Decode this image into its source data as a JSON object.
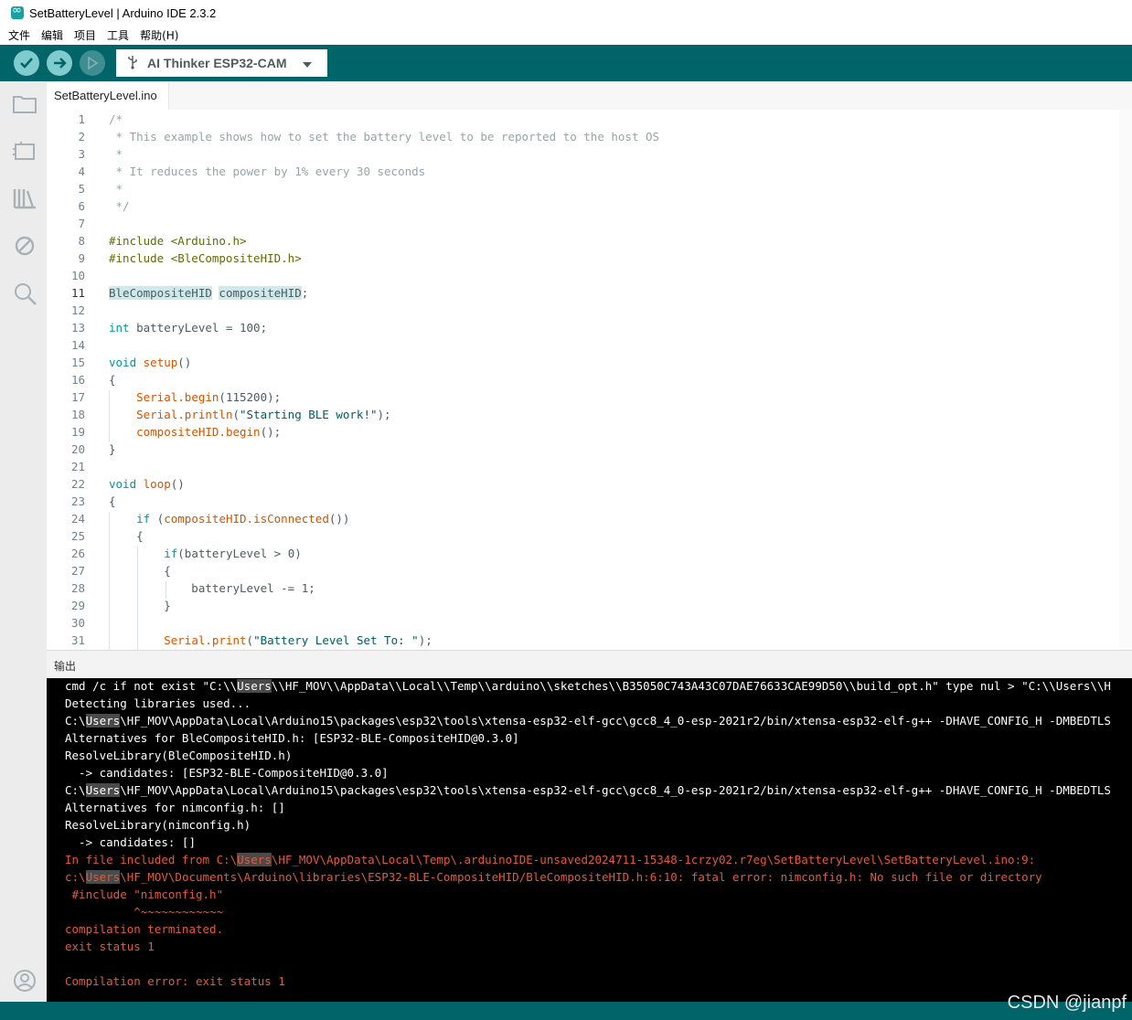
{
  "window": {
    "title": "SetBatteryLevel | Arduino IDE 2.3.2"
  },
  "menu": [
    "文件",
    "编辑",
    "项目",
    "工具",
    "帮助(H)"
  ],
  "toolbar": {
    "board": "AI Thinker ESP32-CAM"
  },
  "tab": {
    "label": "SetBatteryLevel.ino"
  },
  "editor": {
    "active_line": 11,
    "lines": [
      "/*",
      " * This example shows how to set the battery level to be reported to the host OS",
      " *",
      " * It reduces the power by 1% every 30 seconds",
      " *",
      " */",
      "",
      "#include <Arduino.h>",
      "#include <BleCompositeHID.h>",
      "",
      "BleCompositeHID compositeHID;",
      "",
      "int batteryLevel = 100;",
      "",
      "void setup()",
      "{",
      "    Serial.begin(115200);",
      "    Serial.println(\"Starting BLE work!\");",
      "    compositeHID.begin();",
      "}",
      "",
      "void loop()",
      "{",
      "    if (compositeHID.isConnected())",
      "    {",
      "        if(batteryLevel > 0)",
      "        {",
      "            batteryLevel -= 1;",
      "        }",
      "",
      "        Serial.print(\"Battery Level Set To: \");"
    ]
  },
  "output": {
    "label": "输出",
    "lines": [
      {
        "text": "cmd /c if not exist \"C:\\\\Users\\\\HF_MOV\\\\AppData\\\\Local\\\\Temp\\\\arduino\\\\sketches\\\\B35050C743A43C07DAE76633CAE99D50\\\\build_opt.h\" type nul > \"C:\\\\Users\\\\H",
        "err": false
      },
      {
        "text": "Detecting libraries used...",
        "err": false
      },
      {
        "text": "C:\\Users\\HF_MOV\\AppData\\Local\\Arduino15\\packages\\esp32\\tools\\xtensa-esp32-elf-gcc\\gcc8_4_0-esp-2021r2/bin/xtensa-esp32-elf-g++ -DHAVE_CONFIG_H -DMBEDTLS",
        "err": false
      },
      {
        "text": "Alternatives for BleCompositeHID.h: [ESP32-BLE-CompositeHID@0.3.0]",
        "err": false
      },
      {
        "text": "ResolveLibrary(BleCompositeHID.h)",
        "err": false
      },
      {
        "text": "  -> candidates: [ESP32-BLE-CompositeHID@0.3.0]",
        "err": false
      },
      {
        "text": "C:\\Users\\HF_MOV\\AppData\\Local\\Arduino15\\packages\\esp32\\tools\\xtensa-esp32-elf-gcc\\gcc8_4_0-esp-2021r2/bin/xtensa-esp32-elf-g++ -DHAVE_CONFIG_H -DMBEDTLS",
        "err": false
      },
      {
        "text": "Alternatives for nimconfig.h: []",
        "err": false
      },
      {
        "text": "ResolveLibrary(nimconfig.h)",
        "err": false
      },
      {
        "text": "  -> candidates: []",
        "err": false
      },
      {
        "text": "In file included from C:\\Users\\HF_MOV\\AppData\\Local\\Temp\\.arduinoIDE-unsaved2024711-15348-1crzy02.r7eg\\SetBatteryLevel\\SetBatteryLevel.ino:9:",
        "err": true
      },
      {
        "text": "c:\\Users\\HF_MOV\\Documents\\Arduino\\libraries\\ESP32-BLE-CompositeHID/BleCompositeHID.h:6:10: fatal error: nimconfig.h: No such file or directory",
        "err": true
      },
      {
        "text": " #include \"nimconfig.h\"",
        "err": true
      },
      {
        "text": "          ^~~~~~~~~~~~~",
        "err": true
      },
      {
        "text": "compilation terminated.",
        "err": true
      },
      {
        "text": "exit status 1",
        "err": true
      },
      {
        "text": "",
        "err": true
      },
      {
        "text": "Compilation error: exit status 1",
        "err": true
      }
    ]
  },
  "watermark": "CSDN @jianpf",
  "colors": {
    "teal": "#006468",
    "accent": "#00979c",
    "error": "#e35a3c"
  },
  "icons": {
    "toolbar": [
      "verify-icon",
      "upload-icon",
      "debug-icon"
    ],
    "sidebar": [
      "folder-icon",
      "board-manager-icon",
      "library-icon",
      "debug-disabled-icon",
      "search-icon",
      "account-icon"
    ]
  }
}
